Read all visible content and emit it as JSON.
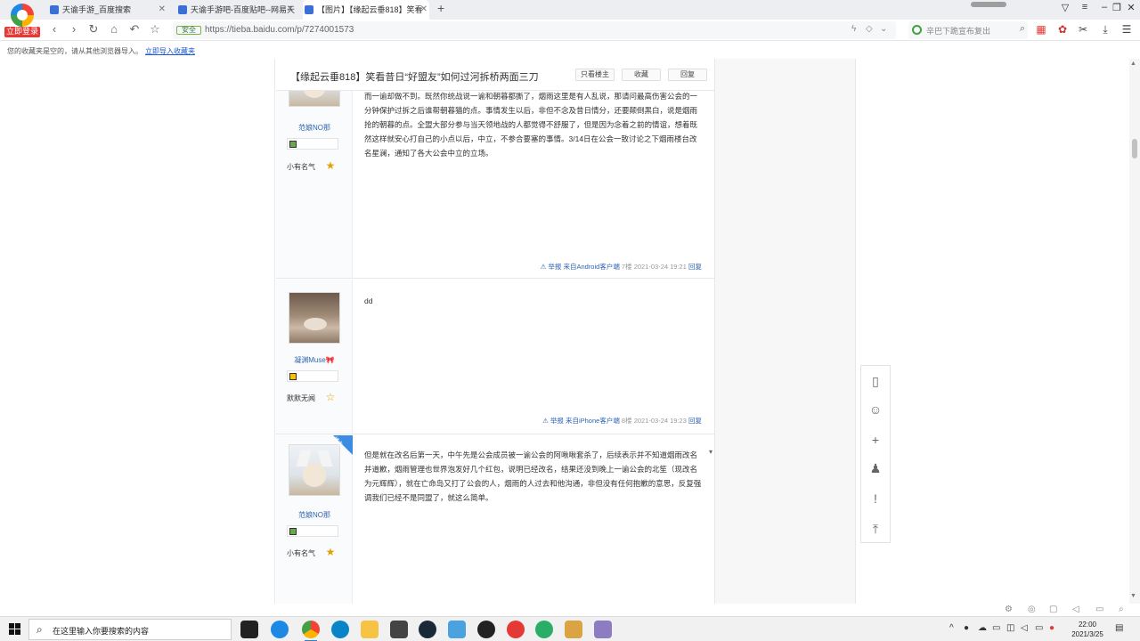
{
  "browser": {
    "badge": "立即登录",
    "tabs": [
      {
        "title": "天谕手游_百度搜索"
      },
      {
        "title": "天谕手游吧-百度贴吧--网易天"
      },
      {
        "title": "【图片】【缘起云垂818】笑看"
      }
    ],
    "url": "https://tieba.baidu.com/p/7274001573",
    "secure_label": "安全",
    "search_placeholder": "辛巴下跪宣布复出",
    "bookmark_message": "您的收藏夹是空的，请从其他浏览器导入。",
    "bookmark_link": "立即导入收藏夹"
  },
  "thread": {
    "title": "【缘起云垂818】笑看昔日“好盟友”如何过河拆桥两面三刀",
    "buttons": {
      "only_op": "只看楼主",
      "favorite": "收藏",
      "reply": "回复"
    }
  },
  "posts": [
    {
      "author": "范娘NO那",
      "rank": "小有名气",
      "level_icon": "level-badge",
      "content": "而一谕却做不到。既然你统战说一谕和朝暮都撕了，烟雨这里是有人乱说，那请问最高伤害公会的一分钟保护过拆之后谁帮朝暮猫的点。事情发生以后，非但不念及昔日情分，还要颠倒黑白，说是烟雨抢的朝暮的点。全盟大部分参与当天领地战的人都觉得不舒服了，但是因为念着之前的情谊，想着既然这样就安心打自己的小点以后，中立，不参合要塞的事情。3/14日在公会一致讨论之下烟雨楼台改名星澜，通知了各大公会中立的立场。",
      "report": "举报",
      "client": "来自Android客户端",
      "floor": "7楼",
      "time": "2021-03-24 19:21",
      "reply": "回复"
    },
    {
      "author": "凝渊Muse🎀",
      "rank": "默默无闻",
      "level_icon": "level-badge",
      "content": "dd",
      "report": "举报",
      "client": "来自iPhone客户端",
      "floor": "8楼",
      "time": "2021-03-24 19:23",
      "reply": "回复"
    },
    {
      "author": "范娘NO那",
      "rank": "小有名气",
      "level_icon": "level-badge",
      "corner_label": "楼主",
      "content": "但是就在改名后第一天，中午先是公会成员被一谕公会的阿啾啾套杀了，后续表示并不知道烟雨改名并道歉，烟雨管理也世界泡发好几个红包，说明已经改名，结果还没到晚上一谕公会的北笙（现改名为元辉辉），就在亡命岛又打了公会的人，烟雨的人过去和他沟通，非但没有任何抱歉的意思，反复强调我们已经不是同盟了，就这么简单。"
    }
  ],
  "sidebar_tools": [
    "client-download-icon",
    "emoji-icon",
    "add-icon",
    "user-icon",
    "feedback-icon",
    "back-to-top-icon"
  ],
  "taskbar": {
    "search_placeholder": "在这里输入你要搜索的内容",
    "time": "22:00",
    "date": "2021/3/25"
  }
}
